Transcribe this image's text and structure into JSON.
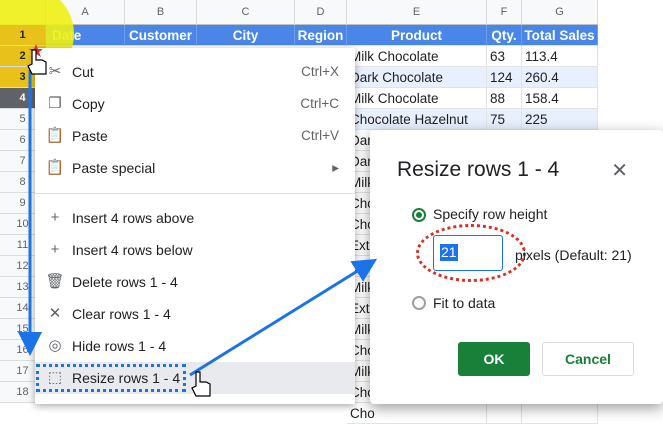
{
  "columns": [
    "A",
    "B",
    "C",
    "D",
    "E",
    "F",
    "G"
  ],
  "row_numbers": [
    "1",
    "2",
    "3",
    "4",
    "5",
    "6",
    "7",
    "8",
    "9",
    "10",
    "11",
    "12",
    "13",
    "14",
    "15",
    "16",
    "17",
    "18"
  ],
  "headers": [
    "Date",
    "Customer",
    "City",
    "Region",
    "Product",
    "Qty.",
    "Total Sales"
  ],
  "rows": [
    {
      "product": "Milk Chocolate",
      "qty": "63",
      "sales": "113.4"
    },
    {
      "product": "Dark Chocolate",
      "qty": "124",
      "sales": "260.4"
    },
    {
      "product": "Milk Chocolate",
      "qty": "88",
      "sales": "158.4"
    },
    {
      "product": "Chocolate Hazelnut",
      "qty": "75",
      "sales": "225"
    }
  ],
  "partial_products": [
    "Dar",
    "Dar",
    "Milk",
    "Cho",
    "Cho",
    "Ext",
    "Cho",
    "Milk",
    "Ext",
    "Milk",
    "Cho",
    "Milk",
    "Cho",
    "Cho"
  ],
  "menu": {
    "cut": {
      "label": "Cut",
      "shortcut": "Ctrl+X",
      "icon": "scissors-icon"
    },
    "copy": {
      "label": "Copy",
      "shortcut": "Ctrl+C",
      "icon": "copy-icon"
    },
    "paste": {
      "label": "Paste",
      "shortcut": "Ctrl+V",
      "icon": "clipboard-icon"
    },
    "paste_special": {
      "label": "Paste special",
      "icon": "clipboard-icon"
    },
    "insert_above": {
      "label": "Insert 4 rows above",
      "icon": "plus-icon"
    },
    "insert_below": {
      "label": "Insert 4 rows below",
      "icon": "plus-icon"
    },
    "delete_rows": {
      "label": "Delete rows 1 - 4",
      "icon": "trash-icon"
    },
    "clear_rows": {
      "label": "Clear rows 1 - 4",
      "icon": "close-icon"
    },
    "hide_rows": {
      "label": "Hide rows 1 - 4",
      "icon": "eye-off-icon"
    },
    "resize_rows": {
      "label": "Resize rows 1 - 4",
      "icon": "resize-icon"
    }
  },
  "dialog": {
    "title": "Resize rows 1 - 4",
    "specify_label": "Specify row height",
    "height_value": "21",
    "pixels_label": "pixels (Default: 21)",
    "fit_label": "Fit to data",
    "ok_label": "OK",
    "cancel_label": "Cancel"
  },
  "colors": {
    "header_blue": "#4a86e8",
    "ok_green": "#188038",
    "annotation_blue": "#1a73e8",
    "annotation_red": "#d93025",
    "highlight_yellow": "#f0f014"
  }
}
